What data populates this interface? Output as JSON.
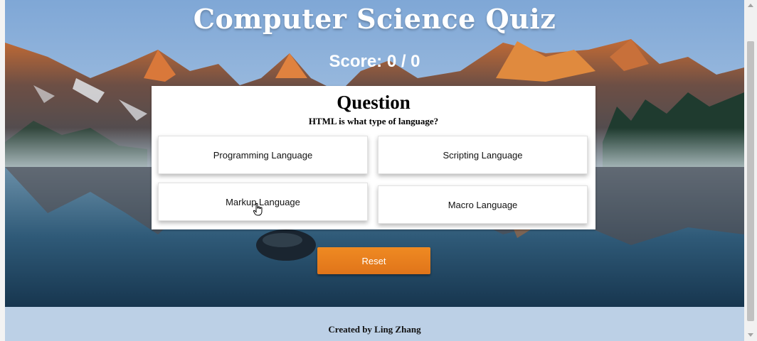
{
  "app": {
    "title": "Computer Science Quiz",
    "score_text": "Score: 0 / 0"
  },
  "question_card": {
    "heading": "Question",
    "question": "HTML is what type of language?",
    "answers": [
      {
        "label": "Programming Language"
      },
      {
        "label": "Scripting Language"
      },
      {
        "label": "Markup Language"
      },
      {
        "label": "Macro Language"
      }
    ]
  },
  "controls": {
    "reset_label": "Reset"
  },
  "footer": {
    "credit": "Created by Ling Zhang"
  },
  "icons": {
    "pointer": "hand-pointer-icon"
  },
  "colors": {
    "accent": "#e8801f",
    "footer_bg": "#bcd0e6",
    "card_bg": "#ffffff"
  }
}
